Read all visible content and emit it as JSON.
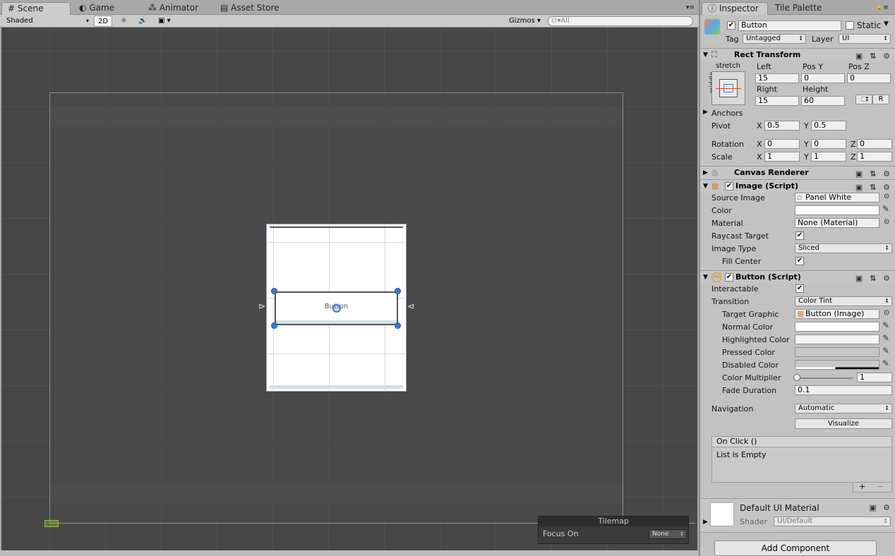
{
  "tabs": {
    "scene": "Scene",
    "game": "Game",
    "animator": "Animator",
    "asset_store": "Asset Store",
    "menu_icon": "menu-icon"
  },
  "toolbar": {
    "draw_mode": "Shaded",
    "mode_2d": "2D",
    "gizmos": "Gizmos",
    "search_placeholder": "All"
  },
  "scene": {
    "button_label": "Button"
  },
  "tilemap": {
    "title": "Tilemap",
    "focus_label": "Focus On",
    "focus_value": "None"
  },
  "inspector": {
    "tabs": {
      "inspector": "Inspector",
      "tile_palette": "Tile Palette"
    },
    "object_name": "Button",
    "static_label": "Static",
    "tag_label": "Tag",
    "tag_value": "Untagged",
    "layer_label": "Layer",
    "layer_value": "UI",
    "rect": {
      "title": "Rect Transform",
      "stretch": "stretch",
      "middle": "middle",
      "left_label": "Left",
      "posy_label": "Pos Y",
      "posz_label": "Pos Z",
      "left": "15",
      "posy": "0",
      "posz": "0",
      "right_label": "Right",
      "height_label": "Height",
      "right": "15",
      "height": "60",
      "r_button": "R",
      "anchors": "Anchors",
      "pivot": "Pivot",
      "pivot_x": "0.5",
      "pivot_y": "0.5",
      "rotation": "Rotation",
      "rot_x": "0",
      "rot_y": "0",
      "rot_z": "0",
      "scale": "Scale",
      "scale_x": "1",
      "scale_y": "1",
      "scale_z": "1",
      "x": "X",
      "y": "Y",
      "z": "Z"
    },
    "canvas_renderer": "Canvas Renderer",
    "image": {
      "title": "Image (Script)",
      "source_image_label": "Source Image",
      "source_image": "Panel White",
      "color_label": "Color",
      "material_label": "Material",
      "material": "None (Material)",
      "raycast_label": "Raycast Target",
      "image_type_label": "Image Type",
      "image_type": "Sliced",
      "fill_center_label": "Fill Center"
    },
    "button": {
      "title": "Button (Script)",
      "interactable_label": "Interactable",
      "transition_label": "Transition",
      "transition": "Color Tint",
      "target_graphic_label": "Target Graphic",
      "target_graphic": "Button (Image)",
      "normal_color_label": "Normal Color",
      "highlighted_color_label": "Highlighted Color",
      "pressed_color_label": "Pressed Color",
      "disabled_color_label": "Disabled Color",
      "color_multiplier_label": "Color Multiplier",
      "color_multiplier": "1",
      "fade_duration_label": "Fade Duration",
      "fade_duration": "0.1",
      "navigation_label": "Navigation",
      "navigation": "Automatic",
      "visualize": "Visualize",
      "onclick_title": "On Click ()",
      "onclick_empty": "List is Empty",
      "add": "+",
      "remove": "−"
    },
    "material": {
      "name": "Default UI Material",
      "shader_label": "Shader",
      "shader": "UI/Default"
    },
    "add_component": "Add Component"
  },
  "colors": {
    "normal": "#ffffff",
    "highlighted": "#f5f5f5",
    "pressed": "#c8c8c8",
    "disabled": "#c8c8c8"
  }
}
